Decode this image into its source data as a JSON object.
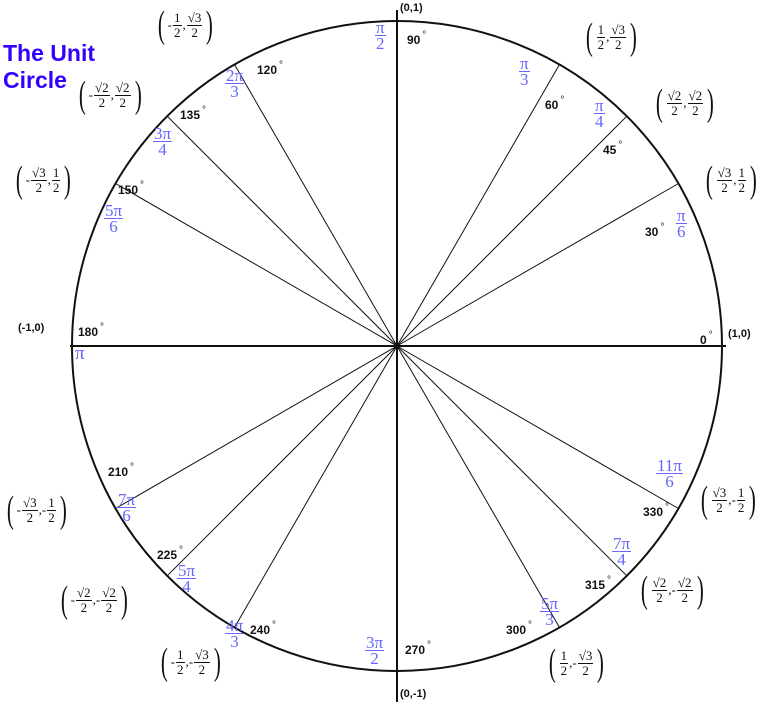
{
  "title_lines": [
    "The Unit",
    "Circle"
  ],
  "colors": {
    "title": "#3300ff",
    "radian": "#6666ff",
    "lines": "#111111"
  },
  "points": [
    {
      "deg": "0",
      "radian": null,
      "coord_text": "(1,0)"
    },
    {
      "deg": "30",
      "radian": {
        "num": "π",
        "den": "6"
      },
      "coord": {
        "x": {
          "sign": "",
          "num": "√3",
          "den": "2"
        },
        "y": {
          "sign": "",
          "num": "1",
          "den": "2"
        }
      }
    },
    {
      "deg": "45",
      "radian": {
        "num": "π",
        "den": "4"
      },
      "coord": {
        "x": {
          "sign": "",
          "num": "√2",
          "den": "2"
        },
        "y": {
          "sign": "",
          "num": "√2",
          "den": "2"
        }
      }
    },
    {
      "deg": "60",
      "radian": {
        "num": "π",
        "den": "3"
      },
      "coord": {
        "x": {
          "sign": "",
          "num": "1",
          "den": "2"
        },
        "y": {
          "sign": "",
          "num": "√3",
          "den": "2"
        }
      }
    },
    {
      "deg": "90",
      "radian": {
        "num": "π",
        "den": "2"
      },
      "coord_text": "(0,1)"
    },
    {
      "deg": "120",
      "radian": {
        "num": "2π",
        "den": "3"
      },
      "coord": {
        "x": {
          "sign": "-",
          "num": "1",
          "den": "2"
        },
        "y": {
          "sign": "",
          "num": "√3",
          "den": "2"
        }
      }
    },
    {
      "deg": "135",
      "radian": {
        "num": "3π",
        "den": "4"
      },
      "coord": {
        "x": {
          "sign": "-",
          "num": "√2",
          "den": "2"
        },
        "y": {
          "sign": "",
          "num": "√2",
          "den": "2"
        }
      }
    },
    {
      "deg": "150",
      "radian": {
        "num": "5π",
        "den": "6"
      },
      "coord": {
        "x": {
          "sign": "-",
          "num": "√3",
          "den": "2"
        },
        "y": {
          "sign": "",
          "num": "1",
          "den": "2"
        }
      }
    },
    {
      "deg": "180",
      "radian": {
        "num": "π",
        "den": ""
      },
      "coord_text": "(-1,0)"
    },
    {
      "deg": "210",
      "radian": {
        "num": "7π",
        "den": "6"
      },
      "coord": {
        "x": {
          "sign": "-",
          "num": "√3",
          "den": "2"
        },
        "y": {
          "sign": "-",
          "num": "1",
          "den": "2"
        }
      }
    },
    {
      "deg": "225",
      "radian": {
        "num": "5π",
        "den": "4"
      },
      "coord": {
        "x": {
          "sign": "-",
          "num": "√2",
          "den": "2"
        },
        "y": {
          "sign": "-",
          "num": "√2",
          "den": "2"
        }
      }
    },
    {
      "deg": "240",
      "radian": {
        "num": "4π",
        "den": "3"
      },
      "coord": {
        "x": {
          "sign": "-",
          "num": "1",
          "den": "2"
        },
        "y": {
          "sign": "-",
          "num": "√3",
          "den": "2"
        }
      }
    },
    {
      "deg": "270",
      "radian": {
        "num": "3π",
        "den": "2"
      },
      "coord_text": "(0,-1)"
    },
    {
      "deg": "300",
      "radian": {
        "num": "5π",
        "den": "3"
      },
      "coord": {
        "x": {
          "sign": "",
          "num": "1",
          "den": "2"
        },
        "y": {
          "sign": "-",
          "num": "√3",
          "den": "2"
        }
      }
    },
    {
      "deg": "315",
      "radian": {
        "num": "7π",
        "den": "4"
      },
      "coord": {
        "x": {
          "sign": "",
          "num": "√2",
          "den": "2"
        },
        "y": {
          "sign": "-",
          "num": "√2",
          "den": "2"
        }
      }
    },
    {
      "deg": "330",
      "radian": {
        "num": "11π",
        "den": "6"
      },
      "coord": {
        "x": {
          "sign": "",
          "num": "√3",
          "den": "2"
        },
        "y": {
          "sign": "-",
          "num": "1",
          "den": "2"
        }
      }
    }
  ]
}
